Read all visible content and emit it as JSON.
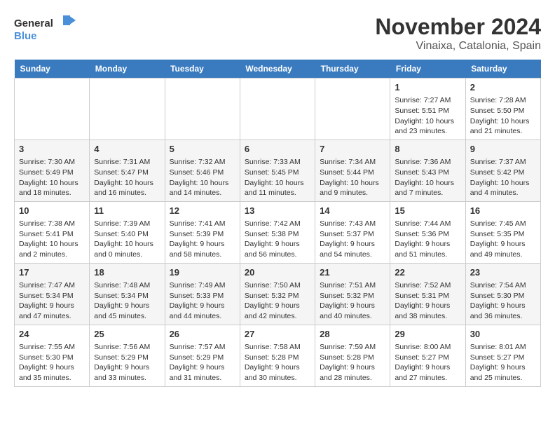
{
  "logo": {
    "line1": "General",
    "line2": "Blue"
  },
  "title": "November 2024",
  "location": "Vinaixa, Catalonia, Spain",
  "days_of_week": [
    "Sunday",
    "Monday",
    "Tuesday",
    "Wednesday",
    "Thursday",
    "Friday",
    "Saturday"
  ],
  "weeks": [
    [
      {
        "day": "",
        "content": ""
      },
      {
        "day": "",
        "content": ""
      },
      {
        "day": "",
        "content": ""
      },
      {
        "day": "",
        "content": ""
      },
      {
        "day": "",
        "content": ""
      },
      {
        "day": "1",
        "content": "Sunrise: 7:27 AM\nSunset: 5:51 PM\nDaylight: 10 hours and 23 minutes."
      },
      {
        "day": "2",
        "content": "Sunrise: 7:28 AM\nSunset: 5:50 PM\nDaylight: 10 hours and 21 minutes."
      }
    ],
    [
      {
        "day": "3",
        "content": "Sunrise: 7:30 AM\nSunset: 5:49 PM\nDaylight: 10 hours and 18 minutes."
      },
      {
        "day": "4",
        "content": "Sunrise: 7:31 AM\nSunset: 5:47 PM\nDaylight: 10 hours and 16 minutes."
      },
      {
        "day": "5",
        "content": "Sunrise: 7:32 AM\nSunset: 5:46 PM\nDaylight: 10 hours and 14 minutes."
      },
      {
        "day": "6",
        "content": "Sunrise: 7:33 AM\nSunset: 5:45 PM\nDaylight: 10 hours and 11 minutes."
      },
      {
        "day": "7",
        "content": "Sunrise: 7:34 AM\nSunset: 5:44 PM\nDaylight: 10 hours and 9 minutes."
      },
      {
        "day": "8",
        "content": "Sunrise: 7:36 AM\nSunset: 5:43 PM\nDaylight: 10 hours and 7 minutes."
      },
      {
        "day": "9",
        "content": "Sunrise: 7:37 AM\nSunset: 5:42 PM\nDaylight: 10 hours and 4 minutes."
      }
    ],
    [
      {
        "day": "10",
        "content": "Sunrise: 7:38 AM\nSunset: 5:41 PM\nDaylight: 10 hours and 2 minutes."
      },
      {
        "day": "11",
        "content": "Sunrise: 7:39 AM\nSunset: 5:40 PM\nDaylight: 10 hours and 0 minutes."
      },
      {
        "day": "12",
        "content": "Sunrise: 7:41 AM\nSunset: 5:39 PM\nDaylight: 9 hours and 58 minutes."
      },
      {
        "day": "13",
        "content": "Sunrise: 7:42 AM\nSunset: 5:38 PM\nDaylight: 9 hours and 56 minutes."
      },
      {
        "day": "14",
        "content": "Sunrise: 7:43 AM\nSunset: 5:37 PM\nDaylight: 9 hours and 54 minutes."
      },
      {
        "day": "15",
        "content": "Sunrise: 7:44 AM\nSunset: 5:36 PM\nDaylight: 9 hours and 51 minutes."
      },
      {
        "day": "16",
        "content": "Sunrise: 7:45 AM\nSunset: 5:35 PM\nDaylight: 9 hours and 49 minutes."
      }
    ],
    [
      {
        "day": "17",
        "content": "Sunrise: 7:47 AM\nSunset: 5:34 PM\nDaylight: 9 hours and 47 minutes."
      },
      {
        "day": "18",
        "content": "Sunrise: 7:48 AM\nSunset: 5:34 PM\nDaylight: 9 hours and 45 minutes."
      },
      {
        "day": "19",
        "content": "Sunrise: 7:49 AM\nSunset: 5:33 PM\nDaylight: 9 hours and 44 minutes."
      },
      {
        "day": "20",
        "content": "Sunrise: 7:50 AM\nSunset: 5:32 PM\nDaylight: 9 hours and 42 minutes."
      },
      {
        "day": "21",
        "content": "Sunrise: 7:51 AM\nSunset: 5:32 PM\nDaylight: 9 hours and 40 minutes."
      },
      {
        "day": "22",
        "content": "Sunrise: 7:52 AM\nSunset: 5:31 PM\nDaylight: 9 hours and 38 minutes."
      },
      {
        "day": "23",
        "content": "Sunrise: 7:54 AM\nSunset: 5:30 PM\nDaylight: 9 hours and 36 minutes."
      }
    ],
    [
      {
        "day": "24",
        "content": "Sunrise: 7:55 AM\nSunset: 5:30 PM\nDaylight: 9 hours and 35 minutes."
      },
      {
        "day": "25",
        "content": "Sunrise: 7:56 AM\nSunset: 5:29 PM\nDaylight: 9 hours and 33 minutes."
      },
      {
        "day": "26",
        "content": "Sunrise: 7:57 AM\nSunset: 5:29 PM\nDaylight: 9 hours and 31 minutes."
      },
      {
        "day": "27",
        "content": "Sunrise: 7:58 AM\nSunset: 5:28 PM\nDaylight: 9 hours and 30 minutes."
      },
      {
        "day": "28",
        "content": "Sunrise: 7:59 AM\nSunset: 5:28 PM\nDaylight: 9 hours and 28 minutes."
      },
      {
        "day": "29",
        "content": "Sunrise: 8:00 AM\nSunset: 5:27 PM\nDaylight: 9 hours and 27 minutes."
      },
      {
        "day": "30",
        "content": "Sunrise: 8:01 AM\nSunset: 5:27 PM\nDaylight: 9 hours and 25 minutes."
      }
    ]
  ]
}
